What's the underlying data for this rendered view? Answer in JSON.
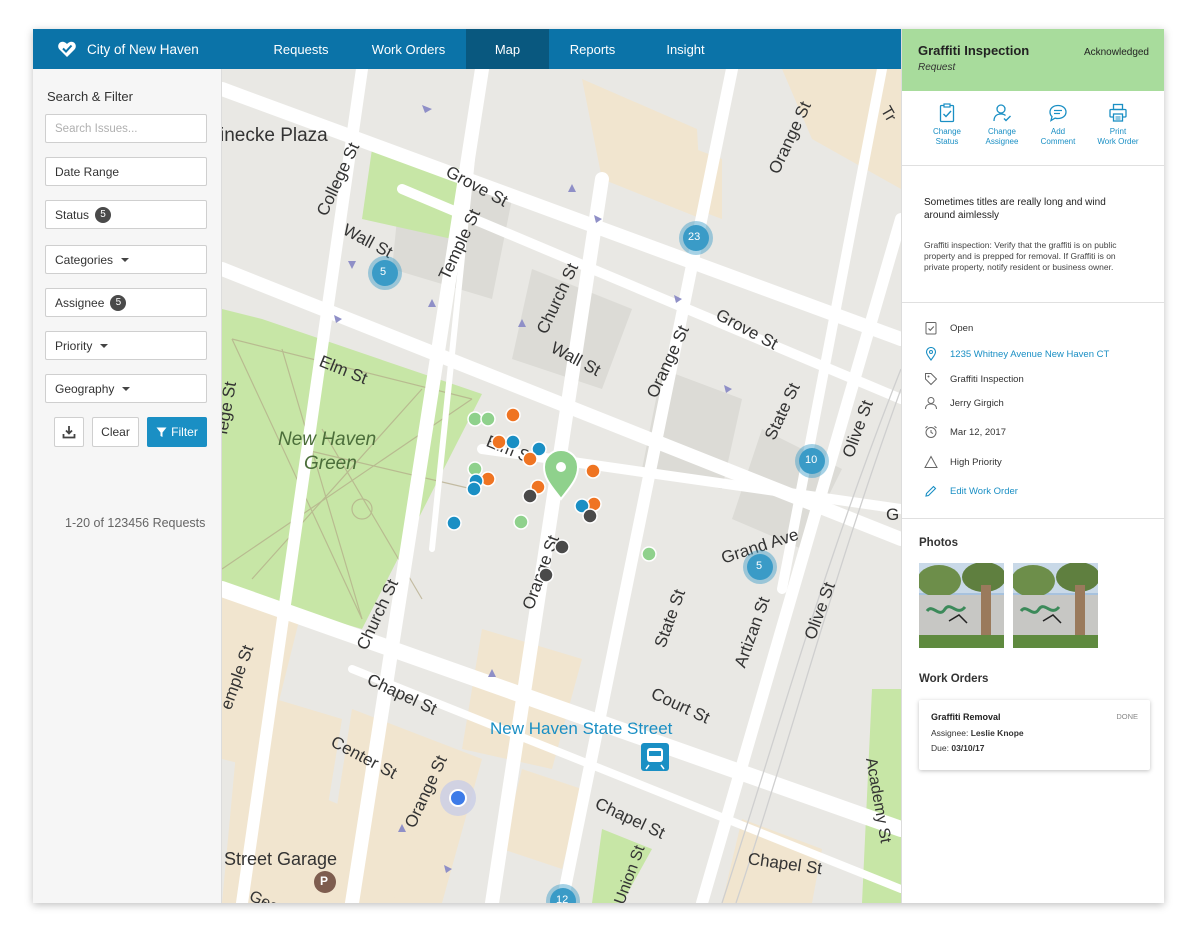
{
  "app": {
    "name": "City of New Haven"
  },
  "nav": {
    "items": [
      {
        "label": "Requests"
      },
      {
        "label": "Work Orders"
      },
      {
        "label": "Map",
        "active": true
      },
      {
        "label": "Reports"
      },
      {
        "label": "Insight"
      }
    ]
  },
  "sidebar": {
    "title": "Search & Filter",
    "search_placeholder": "Search Issues...",
    "filters": {
      "date_range": "Date Range",
      "status": "Status",
      "status_count": "5",
      "categories": "Categories",
      "assignee": "Assignee",
      "assignee_count": "5",
      "priority": "Priority",
      "geography": "Geography"
    },
    "buttons": {
      "clear": "Clear",
      "filter": "Filter"
    },
    "result_count": "1-20 of 123456 Requests"
  },
  "map": {
    "labels": {
      "plaza": "inecke Plaza",
      "grove_st_1": "Grove St",
      "grove_st_2": "Grove St",
      "wall_st_1": "Wall St",
      "wall_st_2": "Wall St",
      "college_st": "College St",
      "temple_st_1": "Temple St",
      "temple_st_2": "emple St",
      "church_st_1": "Church St",
      "church_st_2": "Church St",
      "orange_st_1": "Orange St",
      "orange_st_2": "Orange St",
      "orange_st_3": "Orange St",
      "orange_st_4": "Orange St",
      "elm_st_1": "Elm St",
      "elm_st_2": "Elm St",
      "green_1": "New Haven",
      "green_2": "Green",
      "state_st_1": "State St",
      "state_st_2": "State St",
      "olive_st_1": "Olive St",
      "olive_st_2": "Olive St",
      "grand_ave": "Grand Ave",
      "artizan_st": "Artizan St",
      "chapel_st_1": "Chapel St",
      "chapel_st_2": "Chapel St",
      "chapel_st_3": "Chapel St",
      "court_st": "Court St",
      "center_st": "Center St",
      "station": "New Haven State Street",
      "garage": "Street Garage",
      "george_st": "George St",
      "union_st": "Union St",
      "academy_st": "Academy St",
      "tr": "Tr",
      "lege_st": "lege St",
      "g_edge": "G"
    },
    "clusters": [
      "5",
      "23",
      "10",
      "5",
      "12"
    ],
    "parking_icon": "P"
  },
  "panel": {
    "title": "Graffiti Inspection",
    "subtitle": "Request",
    "status": "Acknowledged",
    "actions": [
      {
        "label1": "Change",
        "label2": "Status",
        "icon": "clipboard-check-icon"
      },
      {
        "label1": "Change",
        "label2": "Assignee",
        "icon": "person-check-icon"
      },
      {
        "label1": "Add",
        "label2": "Comment",
        "icon": "comment-icon"
      },
      {
        "label1": "Print",
        "label2": "Work Order",
        "icon": "printer-icon"
      }
    ],
    "description_title": "Sometimes titles are really long and wind around aimlessly",
    "description_body": "Graffiti inspection: Verify that the graffiti is on public property and is prepped for removal. If Graffiti is on private property, notify resident or business owner.",
    "meta": {
      "status": "Open",
      "address": "1235 Whitney Avenue New Haven CT",
      "category": "Graffiti Inspection",
      "assignee": "Jerry Girgich",
      "date": "Mar 12, 2017",
      "priority": "High Priority",
      "edit": "Edit Work Order"
    },
    "photos_title": "Photos",
    "work_orders_title": "Work Orders",
    "work_order": {
      "title": "Graffiti Removal",
      "status": "DONE",
      "assignee_label": "Assignee:",
      "assignee": "Leslie Knope",
      "due_label": "Due:",
      "due": "03/10/17"
    }
  },
  "colors": {
    "nav": "#0b73a8",
    "nav_active": "#09587f",
    "accent": "#1a8fc4",
    "header_green": "#a8dc9c",
    "pin_orange": "#ef7422",
    "pin_blue": "#1a8fc4",
    "pin_green": "#8fd18c",
    "pin_dark": "#4a4a4a"
  }
}
